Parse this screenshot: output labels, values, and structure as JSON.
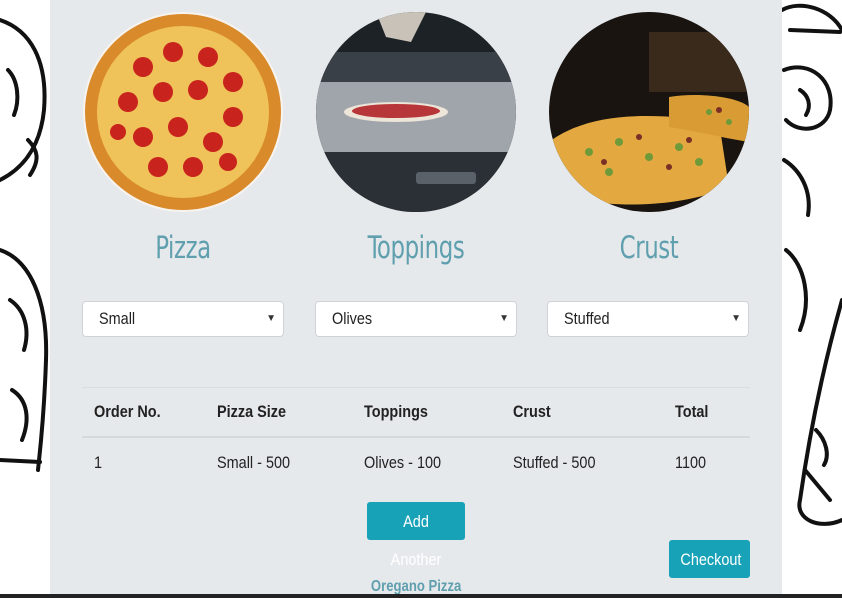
{
  "categories": [
    {
      "title": "Pizza",
      "image": "pepperoni-pizza-photo",
      "selected": "Small"
    },
    {
      "title": "Toppings",
      "image": "pizza-oven-photo",
      "selected": "Olives"
    },
    {
      "title": "Crust",
      "image": "veggie-pizza-photo",
      "selected": "Stuffed"
    }
  ],
  "order_table": {
    "headers": [
      "Order No.",
      "Pizza Size",
      "Toppings",
      "Crust",
      "Total"
    ],
    "rows": [
      [
        "1",
        "Small - 500",
        "Olives - 100",
        "Stuffed - 500",
        "1100"
      ]
    ]
  },
  "buttons": {
    "add_another": "Add Another",
    "checkout": "Checkout"
  },
  "footer": {
    "brand_link": "Oregano Pizza"
  },
  "icons": {
    "select_caret": "caret-down-icon"
  },
  "colors": {
    "accent_text": "#5f9fae",
    "button": "#17a2b8",
    "panel": "#e6e9ec"
  }
}
